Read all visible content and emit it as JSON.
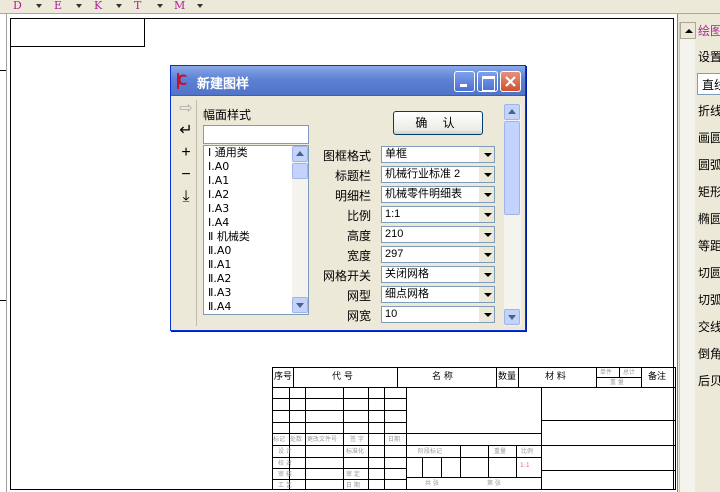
{
  "menu": {
    "items": [
      "D",
      "E",
      "K",
      "T",
      "M"
    ]
  },
  "title_block": {
    "headers": [
      "序号",
      "代 号",
      "名 称",
      "数量",
      "材 料",
      "备注"
    ],
    "small_headers": [
      "单件",
      "总计",
      "重 量"
    ],
    "sign_labels": [
      "标记",
      "处数",
      "更改文件号",
      "签 字",
      "日期"
    ],
    "rows": [
      "设 计",
      "校 对",
      "审 核",
      "工 艺"
    ],
    "mid_labels": [
      "标准化",
      "审 定",
      "日 期",
      "阶段标记",
      "重量",
      "比例",
      "共 张",
      "第 张"
    ]
  },
  "right_panel": {
    "commands": [
      "绘图",
      "设置",
      "直线",
      "折线",
      "画圆",
      "圆弧",
      "矩形",
      "椭圆",
      "等距",
      "切圆",
      "切弧",
      "交线",
      "倒角",
      "后贝"
    ]
  },
  "dialog": {
    "title": "新建图样",
    "group_label": "幅面样式",
    "ok_label": "确  认",
    "tools": [
      "⇨",
      "↵",
      "+",
      "−",
      "⤓"
    ],
    "list_items": [
      "Ⅰ 通用类",
      "Ⅰ.A0",
      "Ⅰ.A1",
      "Ⅰ.A2",
      "Ⅰ.A3",
      "Ⅰ.A4",
      "Ⅱ 机械类",
      "Ⅱ.A0",
      "Ⅱ.A1",
      "Ⅱ.A2",
      "Ⅱ.A3",
      "Ⅱ.A4"
    ],
    "fields": [
      {
        "label": "图框格式",
        "value": "单框"
      },
      {
        "label": "标题栏",
        "value": "机械行业标准  2"
      },
      {
        "label": "明细栏",
        "value": "机械零件明细表"
      },
      {
        "label": "比例",
        "value": "1:1"
      },
      {
        "label": "高度",
        "value": "210"
      },
      {
        "label": "宽度",
        "value": "297"
      },
      {
        "label": "网格开关",
        "value": "关闭网格"
      },
      {
        "label": "网型",
        "value": "细点网格"
      },
      {
        "label": "网宽",
        "value": "10"
      }
    ]
  }
}
